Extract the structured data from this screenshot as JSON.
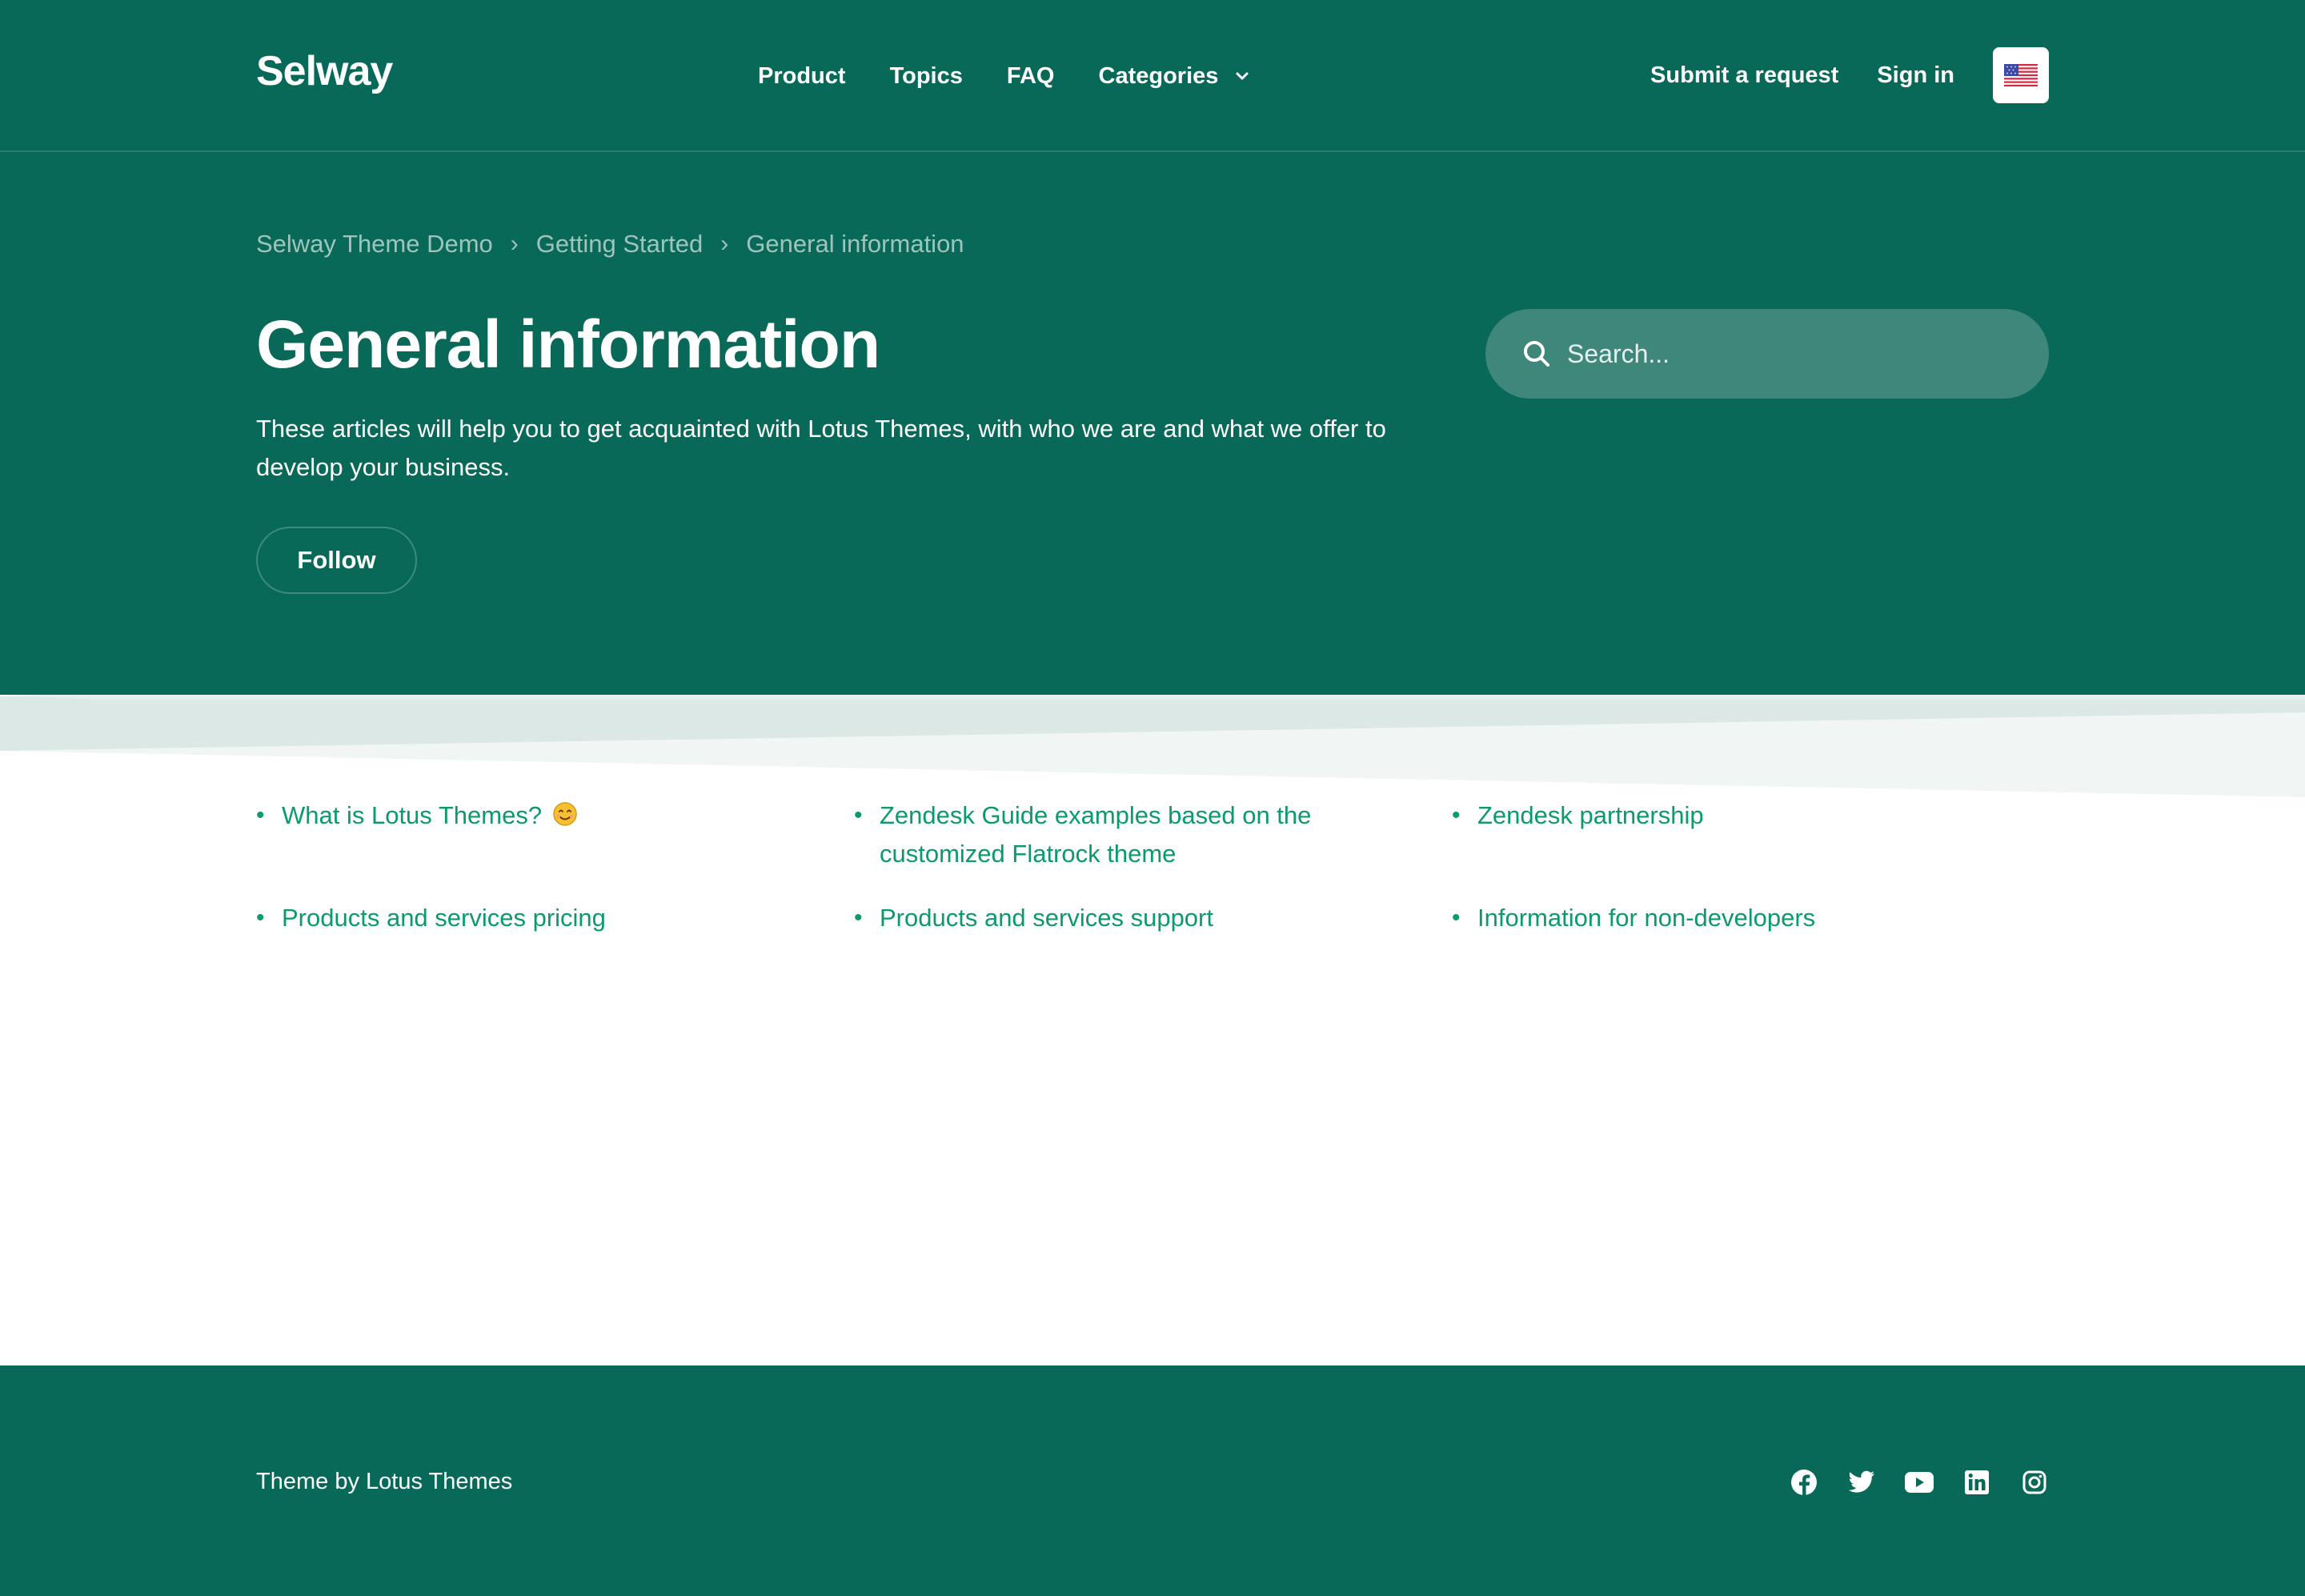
{
  "header": {
    "logo": "Selway",
    "nav": [
      {
        "label": "Product"
      },
      {
        "label": "Topics"
      },
      {
        "label": "FAQ"
      },
      {
        "label": "Categories"
      }
    ],
    "submit_request": "Submit a request",
    "sign_in": "Sign in",
    "language_flag": "us-flag-icon"
  },
  "hero": {
    "breadcrumb": [
      "Selway Theme Demo",
      "Getting Started",
      "General information"
    ],
    "breadcrumb_separator": "›",
    "title": "General information",
    "description": "These articles will help you to get acquainted with Lotus Themes, with who we are and what we offer to develop your business.",
    "follow_label": "Follow",
    "search_placeholder": "Search..."
  },
  "articles": [
    {
      "title": "What is Lotus Themes?",
      "emoji": "smiley-icon"
    },
    {
      "title": "Zendesk Guide examples based on the customized Flatrock theme"
    },
    {
      "title": "Zendesk partnership"
    },
    {
      "title": "Products and services pricing"
    },
    {
      "title": "Products and services support"
    },
    {
      "title": "Information for non-developers"
    }
  ],
  "footer": {
    "credit": "Theme by Lotus Themes",
    "social": [
      "facebook-icon",
      "twitter-icon",
      "youtube-icon",
      "linkedin-icon",
      "instagram-icon"
    ]
  },
  "colors": {
    "primary": "#086958",
    "link": "#0b9a6e",
    "search_bg": "#3f877b",
    "breadcrumb": "#9fc4bc"
  }
}
